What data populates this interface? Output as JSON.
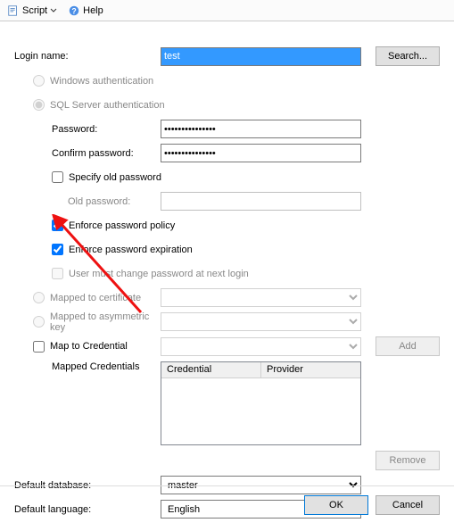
{
  "toolbar": {
    "script_label": "Script",
    "help_label": "Help"
  },
  "labels": {
    "login_name": "Login name:",
    "search": "Search...",
    "windows_auth": "Windows authentication",
    "sql_auth": "SQL Server authentication",
    "password": "Password:",
    "confirm_password": "Confirm password:",
    "specify_old": "Specify old password",
    "old_password": "Old password:",
    "enforce_policy": "Enforce password policy",
    "enforce_expiration": "Enforce password expiration",
    "user_must_change": "User must change password at next login",
    "mapped_cert": "Mapped to certificate",
    "mapped_asym": "Mapped to asymmetric key",
    "map_cred": "Map to Credential",
    "mapped_creds": "Mapped Credentials",
    "add": "Add",
    "remove": "Remove",
    "default_db": "Default database:",
    "default_lang": "Default language:",
    "ok": "OK",
    "cancel": "Cancel"
  },
  "grid": {
    "col1": "Credential",
    "col2": "Provider"
  },
  "values": {
    "login_name": "test",
    "password": "•••••••••••••••",
    "confirm_password": "•••••••••••••••",
    "old_password": "",
    "default_db": "master",
    "default_lang": "English"
  },
  "state": {
    "auth_mode": "sql",
    "specify_old_checked": false,
    "enforce_policy_checked": true,
    "enforce_expiration_checked": true,
    "user_must_change_checked": false,
    "map_cred_checked": false
  }
}
